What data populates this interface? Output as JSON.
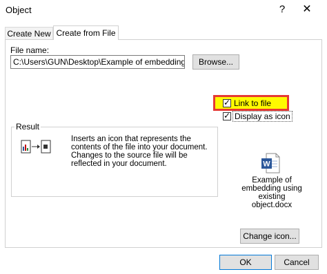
{
  "window": {
    "title": "Object",
    "help_glyph": "?",
    "close_glyph": "✕"
  },
  "tabs": [
    {
      "label": "Create New",
      "active": false
    },
    {
      "label": "Create from File",
      "active": true
    }
  ],
  "file": {
    "label": "File name:",
    "value": "C:\\Users\\GUN\\Desktop\\Example of embedding usin(",
    "browse_label": "Browse..."
  },
  "options": {
    "link_label": "Link to file",
    "link_checked": true,
    "display_label": "Display as icon",
    "display_checked": true,
    "highlight_color": "#fffa00",
    "highlight_border": "#e53935"
  },
  "result": {
    "legend": "Result",
    "text": "Inserts an icon that represents the contents of the file into your document. Changes to the source file will be reflected in your document."
  },
  "icon_preview": {
    "caption": "Example of embedding using existing object.docx",
    "icon": "word-document-icon",
    "accent": "#2b579a"
  },
  "buttons": {
    "change_icon": "Change icon...",
    "ok": "OK",
    "cancel": "Cancel"
  }
}
